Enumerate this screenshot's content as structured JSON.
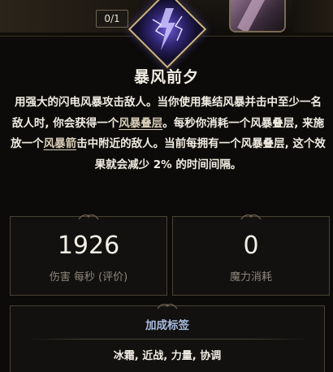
{
  "counter": "0/1",
  "skill": {
    "name": "暴风前夕",
    "icon": "storm-lightning-icon",
    "description": [
      {
        "text": "用强大的闪电风暴攻击敌人。当你使用集结风暴并击中至少一名敌人时, 你会获得一个"
      },
      {
        "text": "风暴叠层",
        "keyword": true
      },
      {
        "text": "。每秒你消耗一个风暴叠层, 来施放一个"
      },
      {
        "text": "风暴箭",
        "keyword": true
      },
      {
        "text": "击中附近的敌人。当前每拥有一个风暴叠层, 这个效果就会减少 2% 的时间间隔。"
      }
    ]
  },
  "stats": {
    "dps": {
      "value": "1926",
      "label": "伤害 每秒 (评价)"
    },
    "mana": {
      "value": "0",
      "label": "魔力消耗"
    }
  },
  "tags": {
    "title": "加成标签",
    "list": "冰霜, 近战, 力量, 协调"
  },
  "colors": {
    "background": "#0c0b09",
    "tag_title": "#a9bde0",
    "border": "#4a4233"
  }
}
